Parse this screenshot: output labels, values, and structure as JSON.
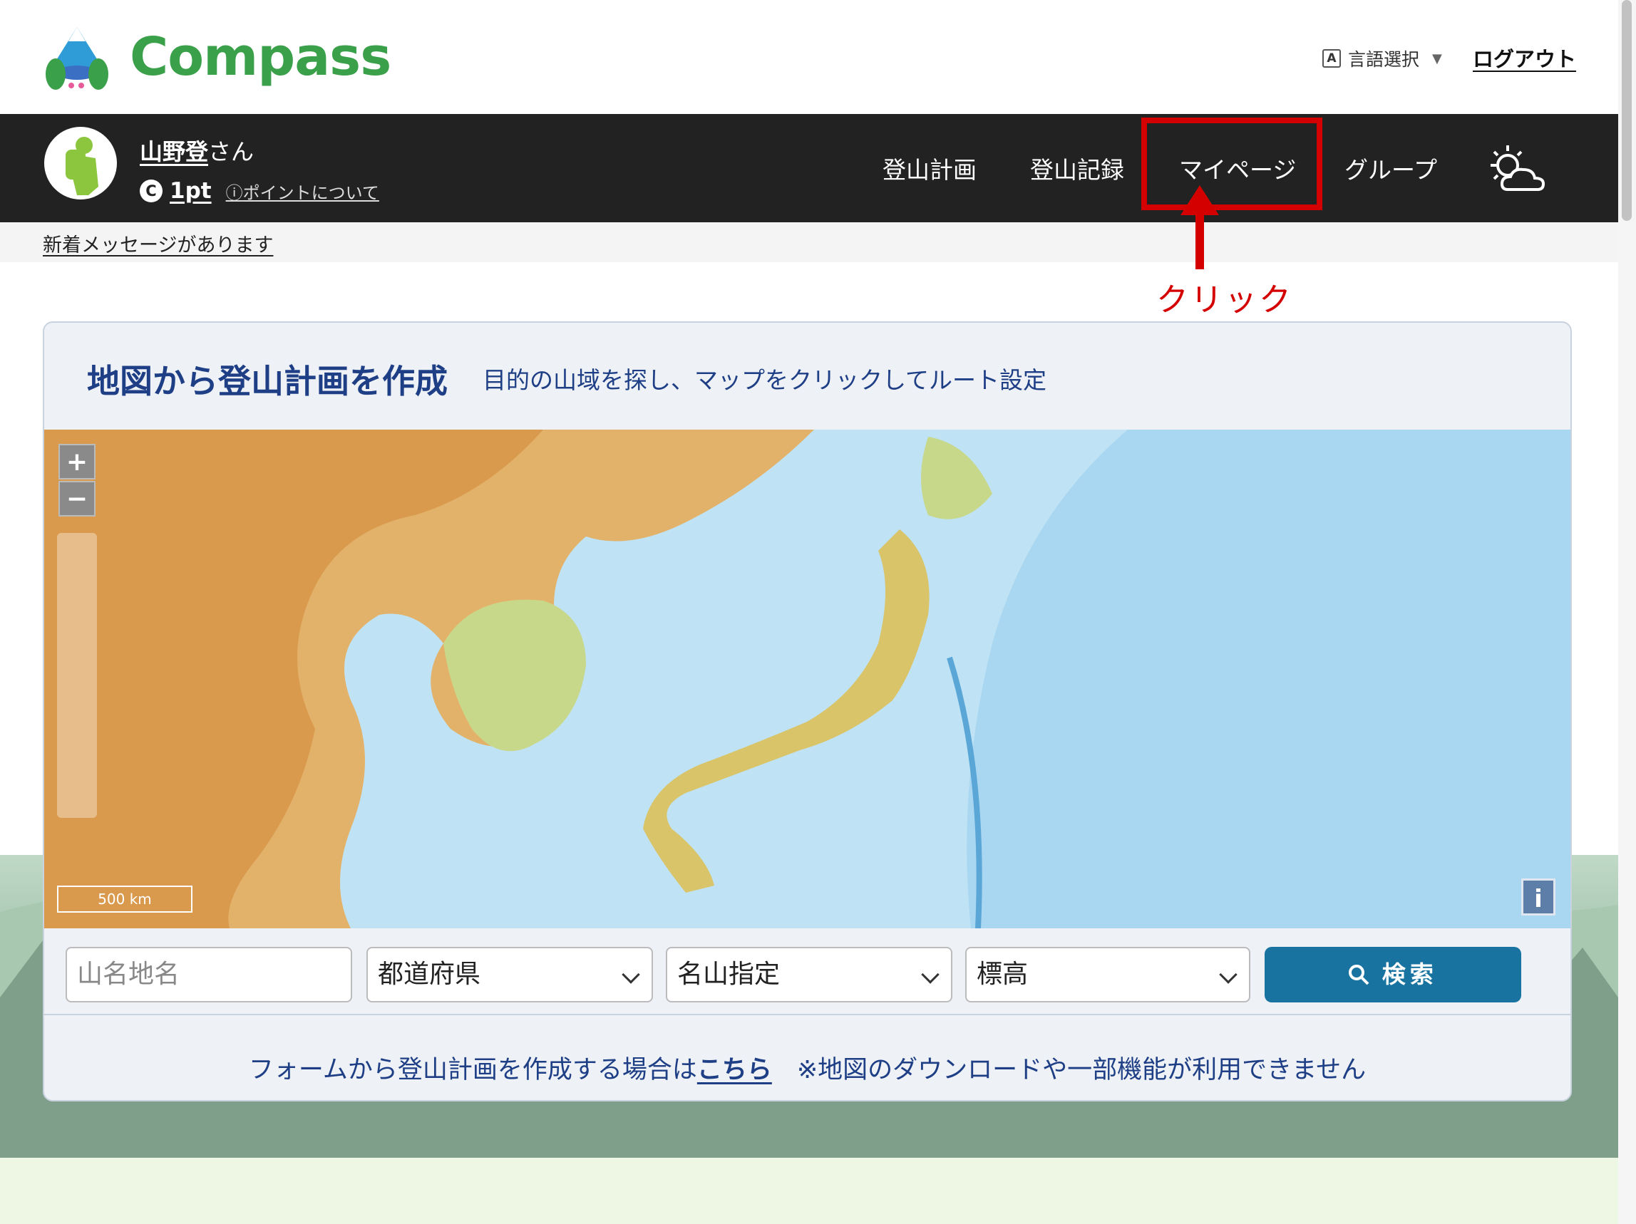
{
  "header": {
    "logo_text": "Compass",
    "language_label": "言語選択",
    "language_box": "A",
    "logout_label": "ログアウト"
  },
  "user": {
    "name": "山野登",
    "suffix": "さん",
    "coin_glyph": "C",
    "points": "1pt",
    "points_about": "ポイントについて"
  },
  "nav": {
    "items": [
      "登山計画",
      "登山記録",
      "マイページ",
      "グループ"
    ],
    "weather_icon": "sun-cloud-icon"
  },
  "message_bar": {
    "text": "新着メッセージがあります"
  },
  "annotation": {
    "click_label": "クリック",
    "color": "#d40000"
  },
  "map_panel": {
    "title": "地図から登山計画を作成",
    "subtitle": "目的の山域を探し、マップをクリックしてルート設定",
    "zoom_in": "+",
    "zoom_out": "−",
    "scale_label": "500 km",
    "info_label": "i"
  },
  "search": {
    "name_placeholder": "山名地名",
    "prefecture": "都道府県",
    "famous_mountain": "名山指定",
    "altitude": "標高",
    "button_label": "検索"
  },
  "form_note": {
    "prefix": "フォームから登山計画を作成する場合は",
    "link": "こちら",
    "suffix": "　※地図のダウンロードや一部機能が利用できません"
  },
  "colors": {
    "brand_green": "#3aa04a",
    "nav_bg": "#222222",
    "title_blue": "#1e3f86",
    "search_button": "#1873a0",
    "highlight": "#d40000"
  }
}
